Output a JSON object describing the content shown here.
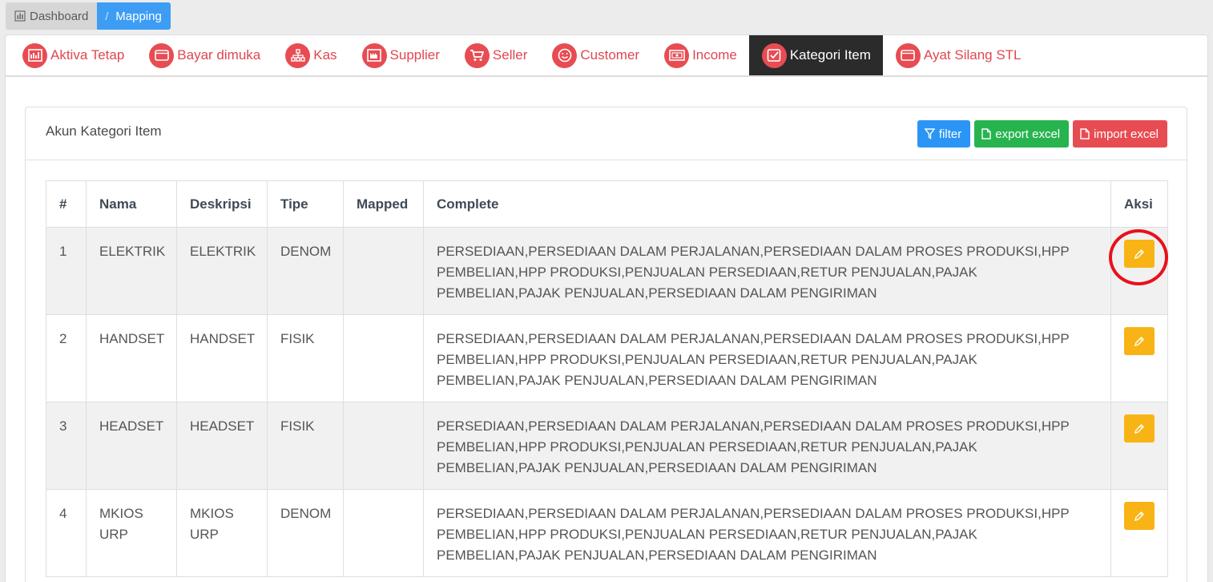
{
  "breadcrumb": {
    "home": "Dashboard",
    "separator": "/",
    "current": "Mapping"
  },
  "tabs": [
    {
      "label": "Aktiva Tetap",
      "icon": "chart-icon"
    },
    {
      "label": "Bayar dimuka",
      "icon": "wallet-icon"
    },
    {
      "label": "Kas",
      "icon": "sitemap-icon"
    },
    {
      "label": "Supplier",
      "icon": "factory-icon"
    },
    {
      "label": "Seller",
      "icon": "cart-icon"
    },
    {
      "label": "Customer",
      "icon": "smile-icon"
    },
    {
      "label": "Income",
      "icon": "money-icon"
    },
    {
      "label": "Kategori Item",
      "icon": "checkbox-icon",
      "active": true
    },
    {
      "label": "Ayat Silang STL",
      "icon": "wallet-icon"
    }
  ],
  "panel": {
    "title": "Akun Kategori Item",
    "filter_label": "filter",
    "export_label": "export excel",
    "import_label": "import excel"
  },
  "table": {
    "headers": [
      "#",
      "Nama",
      "Deskripsi",
      "Tipe",
      "Mapped",
      "Complete",
      "Aksi"
    ],
    "rows": [
      {
        "no": "1",
        "nama": "ELEKTRIK",
        "deskripsi": "ELEKTRIK",
        "tipe": "DENOM",
        "mapped": "",
        "complete": "PERSEDIAAN,PERSEDIAAN DALAM PERJALANAN,PERSEDIAAN DALAM PROSES PRODUKSI,HPP PEMBELIAN,HPP PRODUKSI,PENJUALAN PERSEDIAAN,RETUR PENJUALAN,PAJAK PEMBELIAN,PAJAK PENJUALAN,PERSEDIAAN DALAM PENGIRIMAN"
      },
      {
        "no": "2",
        "nama": "HANDSET",
        "deskripsi": "HANDSET",
        "tipe": "FISIK",
        "mapped": "",
        "complete": "PERSEDIAAN,PERSEDIAAN DALAM PERJALANAN,PERSEDIAAN DALAM PROSES PRODUKSI,HPP PEMBELIAN,HPP PRODUKSI,PENJUALAN PERSEDIAAN,RETUR PENJUALAN,PAJAK PEMBELIAN,PAJAK PENJUALAN,PERSEDIAAN DALAM PENGIRIMAN"
      },
      {
        "no": "3",
        "nama": "HEADSET",
        "deskripsi": "HEADSET",
        "tipe": "FISIK",
        "mapped": "",
        "complete": "PERSEDIAAN,PERSEDIAAN DALAM PERJALANAN,PERSEDIAAN DALAM PROSES PRODUKSI,HPP PEMBELIAN,HPP PRODUKSI,PENJUALAN PERSEDIAAN,RETUR PENJUALAN,PAJAK PEMBELIAN,PAJAK PENJUALAN,PERSEDIAAN DALAM PENGIRIMAN"
      },
      {
        "no": "4",
        "nama": "MKIOS URP",
        "deskripsi": "MKIOS URP",
        "tipe": "DENOM",
        "mapped": "",
        "complete": "PERSEDIAAN,PERSEDIAAN DALAM PERJALANAN,PERSEDIAAN DALAM PROSES PRODUKSI,HPP PEMBELIAN,HPP PRODUKSI,PENJUALAN PERSEDIAAN,RETUR PENJUALAN,PAJAK PEMBELIAN,PAJAK PENJUALAN,PERSEDIAAN DALAM PENGIRIMAN"
      }
    ]
  },
  "colors": {
    "accent_red": "#e84c53",
    "breadcrumb_blue": "#3d9df5",
    "filter_blue": "#2b95f5",
    "export_green": "#27b44f",
    "edit_yellow": "#f8b415",
    "annotation_ring": "#e8111c"
  }
}
